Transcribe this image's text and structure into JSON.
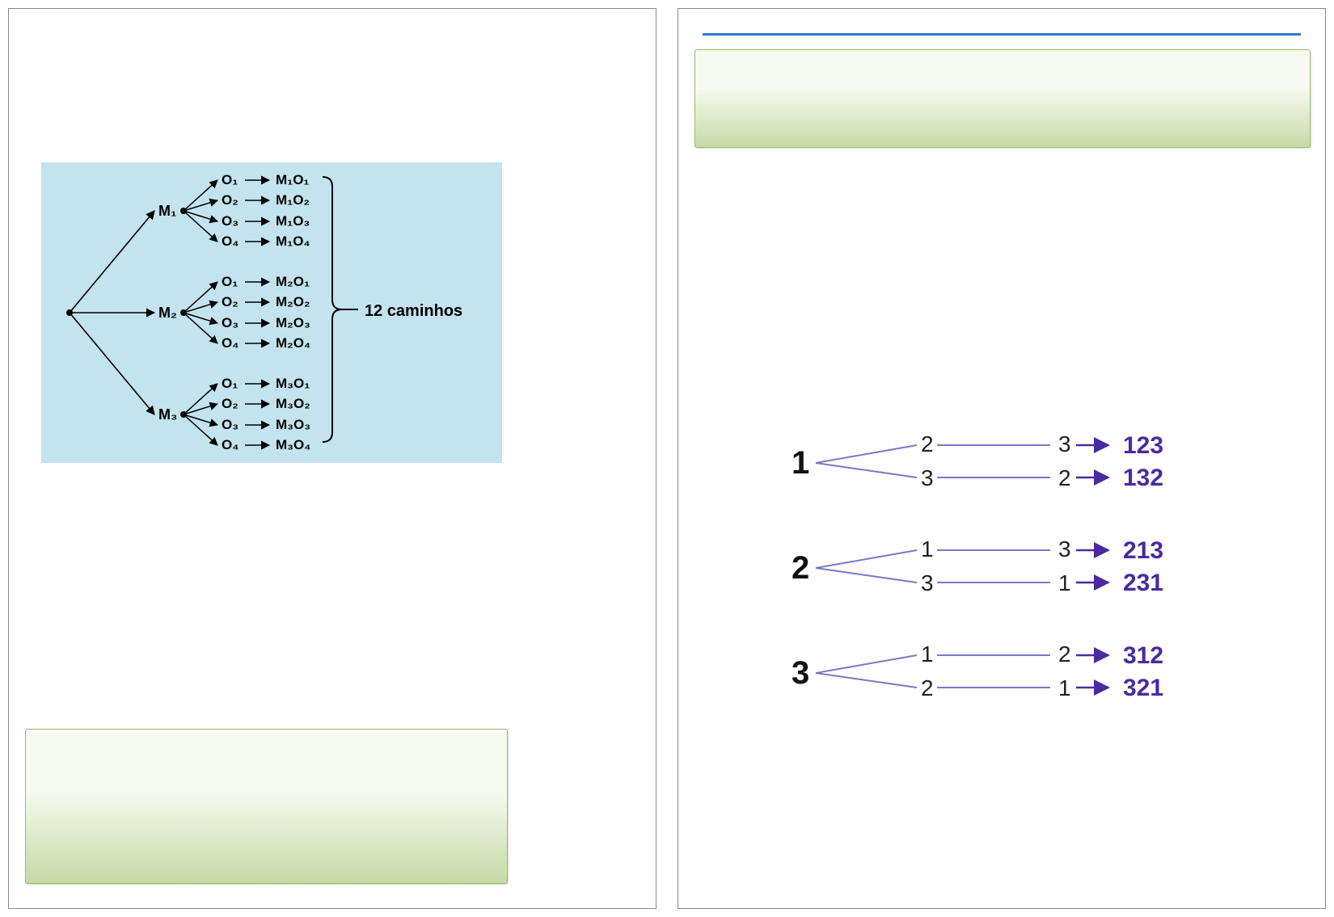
{
  "left": {
    "tree": {
      "m_labels": [
        "M₁",
        "M₂",
        "M₃"
      ],
      "o_labels": [
        "O₁",
        "O₂",
        "O₃",
        "O₄"
      ],
      "results": {
        "M1": [
          "M₁O₁",
          "M₁O₂",
          "M₁O₃",
          "M₁O₄"
        ],
        "M2": [
          "M₂O₁",
          "M₂O₂",
          "M₂O₃",
          "M₂O₄"
        ],
        "M3": [
          "M₃O₁",
          "M₃O₂",
          "M₃O₃",
          "M₃O₄"
        ]
      },
      "summary": "12 caminhos"
    }
  },
  "right": {
    "perm": {
      "groups": [
        {
          "root": "1",
          "branches": [
            {
              "mid": "2",
              "last": "3",
              "res": "123"
            },
            {
              "mid": "3",
              "last": "2",
              "res": "132"
            }
          ]
        },
        {
          "root": "2",
          "branches": [
            {
              "mid": "1",
              "last": "3",
              "res": "213"
            },
            {
              "mid": "3",
              "last": "1",
              "res": "231"
            }
          ]
        },
        {
          "root": "3",
          "branches": [
            {
              "mid": "1",
              "last": "2",
              "res": "312"
            },
            {
              "mid": "2",
              "last": "1",
              "res": "321"
            }
          ]
        }
      ]
    }
  },
  "chart_data": [
    {
      "type": "tree",
      "title": "",
      "root": "",
      "level1": [
        "M1",
        "M2",
        "M3"
      ],
      "level2": [
        "O1",
        "O2",
        "O3",
        "O4"
      ],
      "leaves": [
        "M1O1",
        "M1O2",
        "M1O3",
        "M1O4",
        "M2O1",
        "M2O2",
        "M2O3",
        "M2O4",
        "M3O1",
        "M3O2",
        "M3O3",
        "M3O4"
      ],
      "summary": "12 caminhos"
    },
    {
      "type": "tree",
      "title": "",
      "permutations": [
        [
          1,
          2,
          3
        ],
        [
          1,
          3,
          2
        ],
        [
          2,
          1,
          3
        ],
        [
          2,
          3,
          1
        ],
        [
          3,
          1,
          2
        ],
        [
          3,
          2,
          1
        ]
      ],
      "results": [
        "123",
        "132",
        "213",
        "231",
        "312",
        "321"
      ]
    }
  ]
}
